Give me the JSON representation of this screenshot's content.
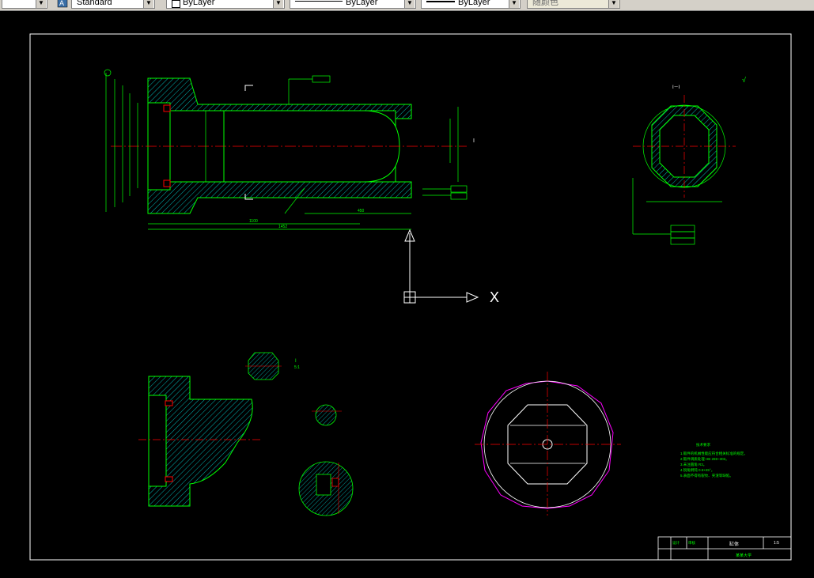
{
  "toolbar": {
    "textstyle_value": "Standard",
    "layer_value": "ByLayer",
    "linetype_value": "ByLayer",
    "lineweight_value": "ByLayer",
    "color_value": "随颜色"
  },
  "drawing": {
    "section_label_top": "I－I",
    "section_label_side": "I",
    "tolerance_rough": "√",
    "x_axis_label": "X",
    "dim_overall": "1452",
    "dim_inner": "1100",
    "dim_partial": "450",
    "view_scale": "5:1",
    "detail_label": "I",
    "tech_title": "技术要求",
    "tech_notes": [
      "1.锻件的机械性能应符合相关标准的规定。",
      "2.锻件调质处理 HB 269~302。",
      "3.未注圆角 R3。",
      "4.锐角倒钝 0.5×45°。",
      "5.表面不得有裂纹、夹渣等缺陷。"
    ],
    "title_block": {
      "part_name": "缸体",
      "scale": "1:5",
      "school": "某某大学",
      "designer": "设计",
      "checker": "审核"
    }
  },
  "colors": {
    "outline": "#00ff00",
    "centerline": "#ff0000",
    "hatch": "#00ffff",
    "dimension": "#00ff00",
    "frame": "#ffffff",
    "magenta": "#ff00ff"
  }
}
